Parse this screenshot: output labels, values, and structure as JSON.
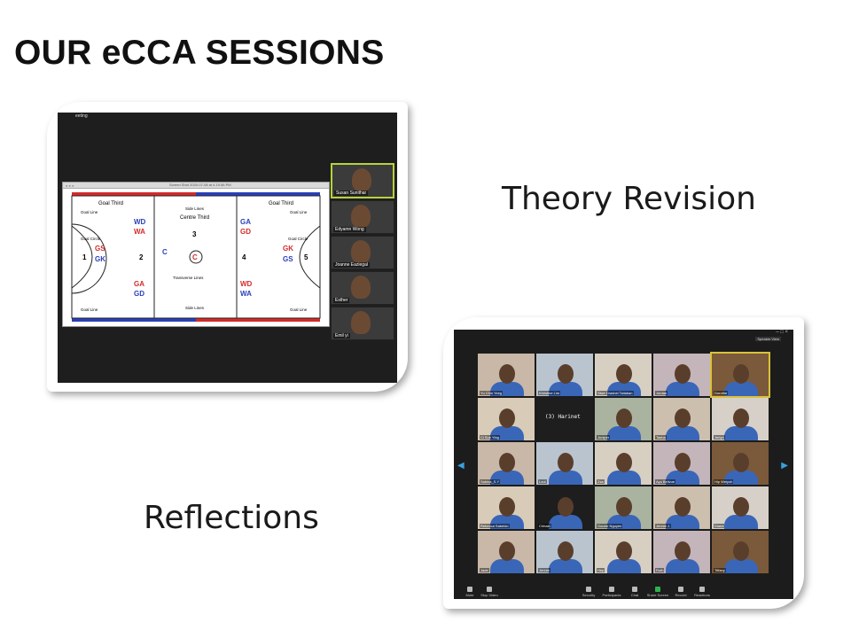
{
  "title": "OUR eCCA SESSIONS",
  "captions": {
    "theory": "Theory Revision",
    "reflections": "Reflections"
  },
  "screenshot1": {
    "meeting_label": "eeting",
    "window_title": "Screen Shot 2020-07-08 at 4.19.56 PM",
    "court": {
      "goal_third_left": "Goal Third",
      "goal_third_right": "Goal Third",
      "centre_third": "Centre Third",
      "goal_line": "Goal Line",
      "goal_circle": "Goal Circle",
      "side_lines": "Side Lines",
      "transverse_lines": "Transverse Lines",
      "zones": [
        "1",
        "2",
        "3",
        "4",
        "5"
      ],
      "positions_left_top": [
        "WD",
        "WA"
      ],
      "positions_left_circle": [
        "GS",
        "GK"
      ],
      "positions_left_bottom": [
        "GA",
        "GD"
      ],
      "positions_right_top": [
        "GA",
        "GD"
      ],
      "positions_right_circle": [
        "GK",
        "GS"
      ],
      "positions_right_bottom": [
        "WD",
        "WA"
      ],
      "centre_c": "C",
      "centre_circle_c": "C",
      "colors": {
        "red": "#d42a2a",
        "blue": "#2a3fb8"
      }
    },
    "participants": [
      "Susan Sunithar",
      "Edyamn Wong",
      "Joanne Eaziegal",
      "Esther",
      "Emil yi"
    ]
  },
  "screenshot2": {
    "window_controls": "–  □  ×",
    "speaker_view": "Speaker View",
    "harinet_label": "(3) Harinet",
    "tiles": [
      "Yu Chin Yeeg",
      "Khristine Lim",
      "Siwe Drashel Tallaban",
      "Jordan",
      "Dorothe",
      "Ci Sue Ying",
      "(3) Harinet",
      "Juniper",
      "Tasha",
      "Jerlyn",
      "Sabina_S.Y",
      "Loui",
      "Zsa",
      "Ayu Bellvue",
      "Hip Weiyuh",
      "Rebecca Sabeido",
      "Chhain",
      "Gourer Nguyen",
      "Jennie J.",
      "Diana",
      "Jade",
      "Jennie",
      "Hep",
      "Ruth",
      "Tiffany"
    ],
    "active_tile": 4,
    "toolbar": [
      "Mute",
      "Stop Video",
      "Security",
      "Participants",
      "Chat",
      "Share Screen",
      "Record",
      "Reactions"
    ]
  }
}
